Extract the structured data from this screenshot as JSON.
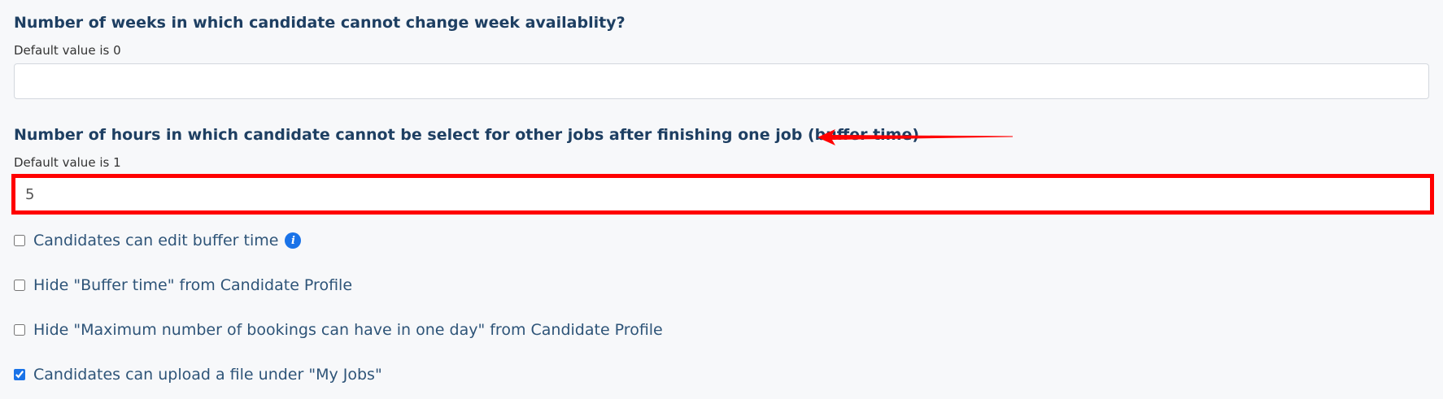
{
  "week_lock": {
    "title": "Number of weeks in which candidate cannot change week availablity?",
    "hint": "Default value is 0",
    "value": ""
  },
  "buffer_time": {
    "title": "Number of hours in which candidate cannot be select for other jobs after finishing one job (buffer time)",
    "hint": "Default value is 1",
    "value": "5"
  },
  "options": [
    {
      "label": "Candidates can edit buffer time",
      "checked": false,
      "has_info": true
    },
    {
      "label": "Hide \"Buffer time\" from Candidate Profile",
      "checked": false
    },
    {
      "label": "Hide \"Maximum number of bookings can have in one day\" from Candidate Profile",
      "checked": false
    },
    {
      "label": "Candidates can upload a file under \"My Jobs\"",
      "checked": true
    }
  ],
  "colors": {
    "highlight": "#ff0000",
    "accent": "#1a73e8",
    "title": "#1e3f62"
  },
  "icons": {
    "info": "info-icon",
    "annotation_arrow": "red-arrow-annotation"
  }
}
